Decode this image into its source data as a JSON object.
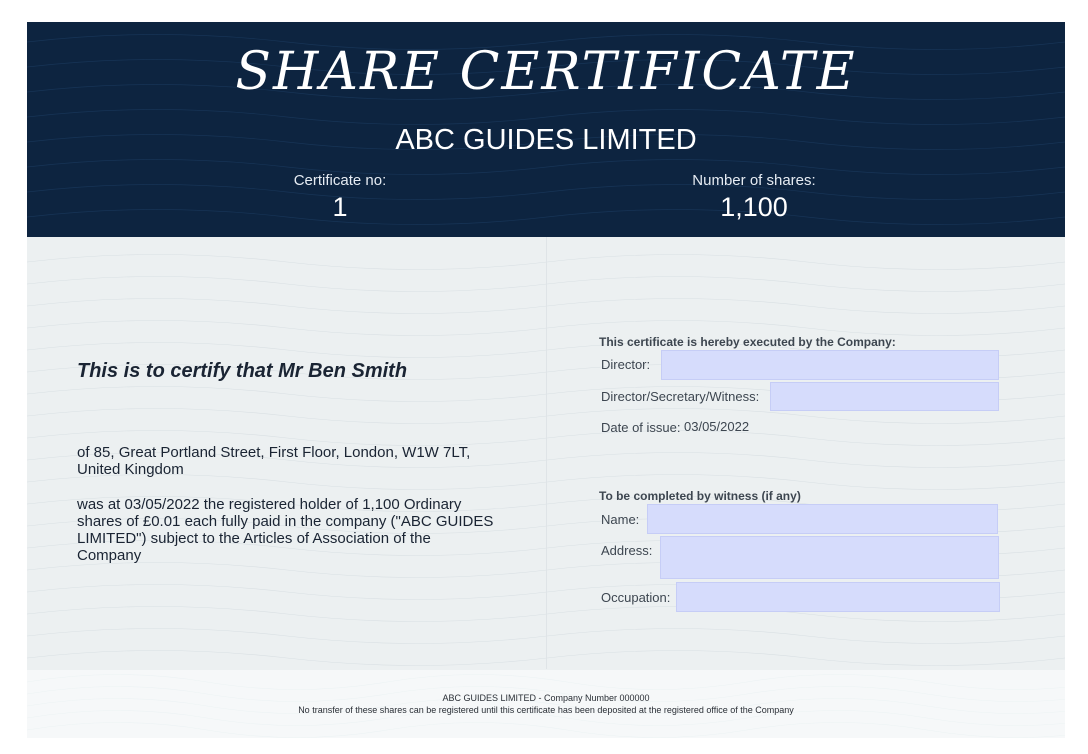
{
  "header": {
    "title": "SHARE CERTIFICATE",
    "company_name": "ABC GUIDES LIMITED",
    "certificate_no_label": "Certificate no:",
    "certificate_no_value": "1",
    "shares_label": "Number of shares:",
    "shares_value": "1,100"
  },
  "body": {
    "certify_line": "This is to certify that Mr Ben Smith",
    "address": "of 85, Great Portland Street, First Floor, London, W1W 7LT, United Kingdom",
    "holding": "was at 03/05/2022 the registered holder of 1,100 Ordinary shares of £0.01 each fully paid in the company (\"ABC GUIDES LIMITED\") subject to the Articles of Association of the Company"
  },
  "execution": {
    "heading": "This certificate is hereby executed by the Company:",
    "director_label": "Director:",
    "director_value": "",
    "secretary_label": "Director/Secretary/Witness:",
    "secretary_value": "",
    "date_label": "Date of issue:",
    "date_value": "03/05/2022"
  },
  "witness": {
    "heading": "To be completed by witness (if any)",
    "name_label": "Name:",
    "name_value": "",
    "address_label": "Address:",
    "address_value": "",
    "occupation_label": "Occupation:",
    "occupation_value": ""
  },
  "footer": {
    "line1": "ABC GUIDES LIMITED - Company Number 000000",
    "line2": "No transfer of these shares can be registered until this certificate has been deposited at the registered office of the Company"
  },
  "colors": {
    "header_bg": "#0d2440",
    "paper_bg": "#ecf0f1",
    "field_bg": "#d6dcfc",
    "text": "#1a2433"
  }
}
